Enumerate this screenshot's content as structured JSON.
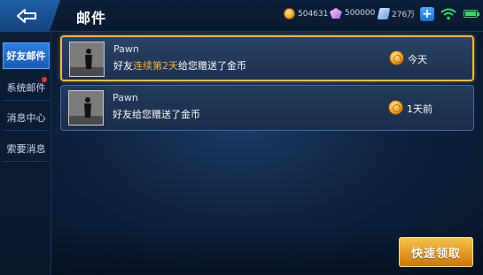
{
  "header": {
    "title": "邮件",
    "coins": "504631",
    "diamonds": "500000",
    "tickets": "276万"
  },
  "sidebar": {
    "items": [
      {
        "label": "好友邮件",
        "active": true,
        "dot": false
      },
      {
        "label": "系统邮件",
        "active": false,
        "dot": true
      },
      {
        "label": "消息中心",
        "active": false,
        "dot": false
      },
      {
        "label": "索要消息",
        "active": false,
        "dot": false
      }
    ]
  },
  "mails": [
    {
      "sender": "Pawn",
      "msg_prefix": "好友",
      "msg_highlight": "连续第2天",
      "msg_suffix": "给您赠送了金币",
      "date": "今天",
      "selected": true
    },
    {
      "sender": "Pawn",
      "msg_prefix": "好友给您赠送了金币",
      "msg_highlight": "",
      "msg_suffix": "",
      "date": "1天前",
      "selected": false
    }
  ],
  "actions": {
    "quick_claim": "快速领取"
  },
  "colors": {
    "accent_gold": "#e8b94a",
    "highlight_text": "#f0b23c",
    "active_tab": "#2f7fe0",
    "notification_dot": "#e8343a"
  }
}
